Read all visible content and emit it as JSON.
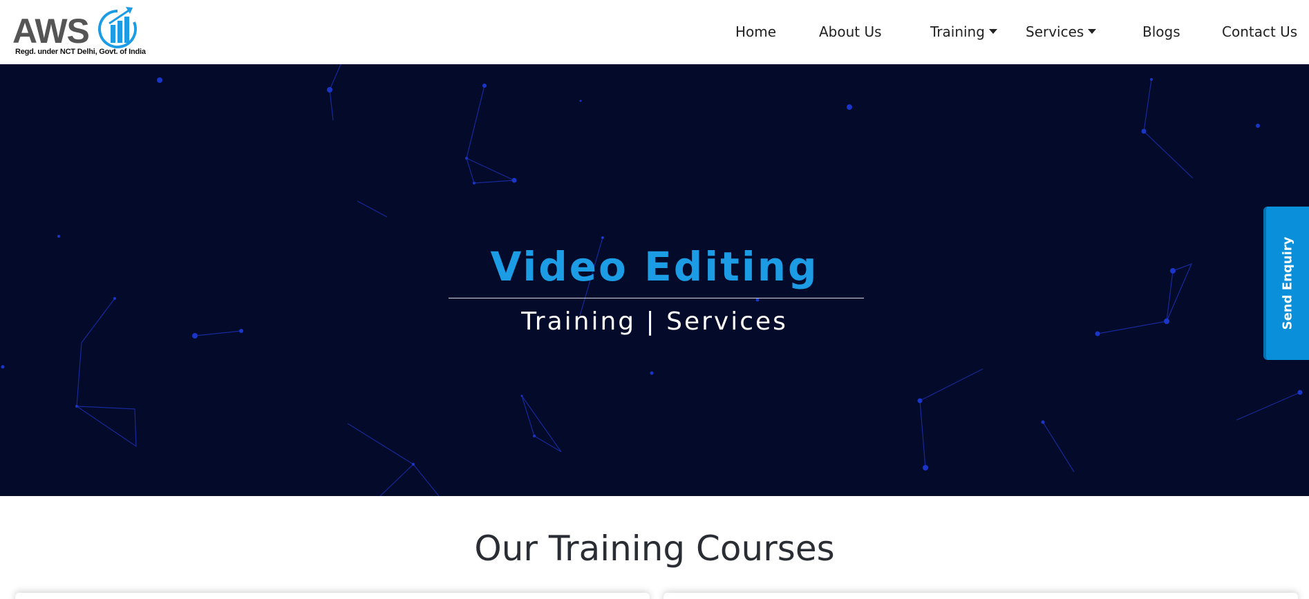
{
  "logo": {
    "text": "AWS",
    "subtitle": "Regd. under NCT Delhi, Govt. of India",
    "colors": {
      "text": "#555555",
      "mark": "#1c9ce4"
    }
  },
  "nav": {
    "items": [
      {
        "label": "Home",
        "dropdown": false
      },
      {
        "label": "About Us",
        "dropdown": false
      },
      {
        "label": "Training",
        "dropdown": true
      },
      {
        "label": "Services",
        "dropdown": true
      },
      {
        "label": "Blogs",
        "dropdown": false
      },
      {
        "label": "Contact Us",
        "dropdown": false
      }
    ]
  },
  "hero": {
    "title": "Video Editing",
    "subtitle": "Training | Services",
    "colors": {
      "background": "#040a29",
      "title": "#1c9ce4",
      "network": "#1a2fb0"
    }
  },
  "enquiry": {
    "label": "Send Enquiry",
    "color": "#0a8fdb"
  },
  "courses": {
    "title": "Our Training Courses"
  }
}
